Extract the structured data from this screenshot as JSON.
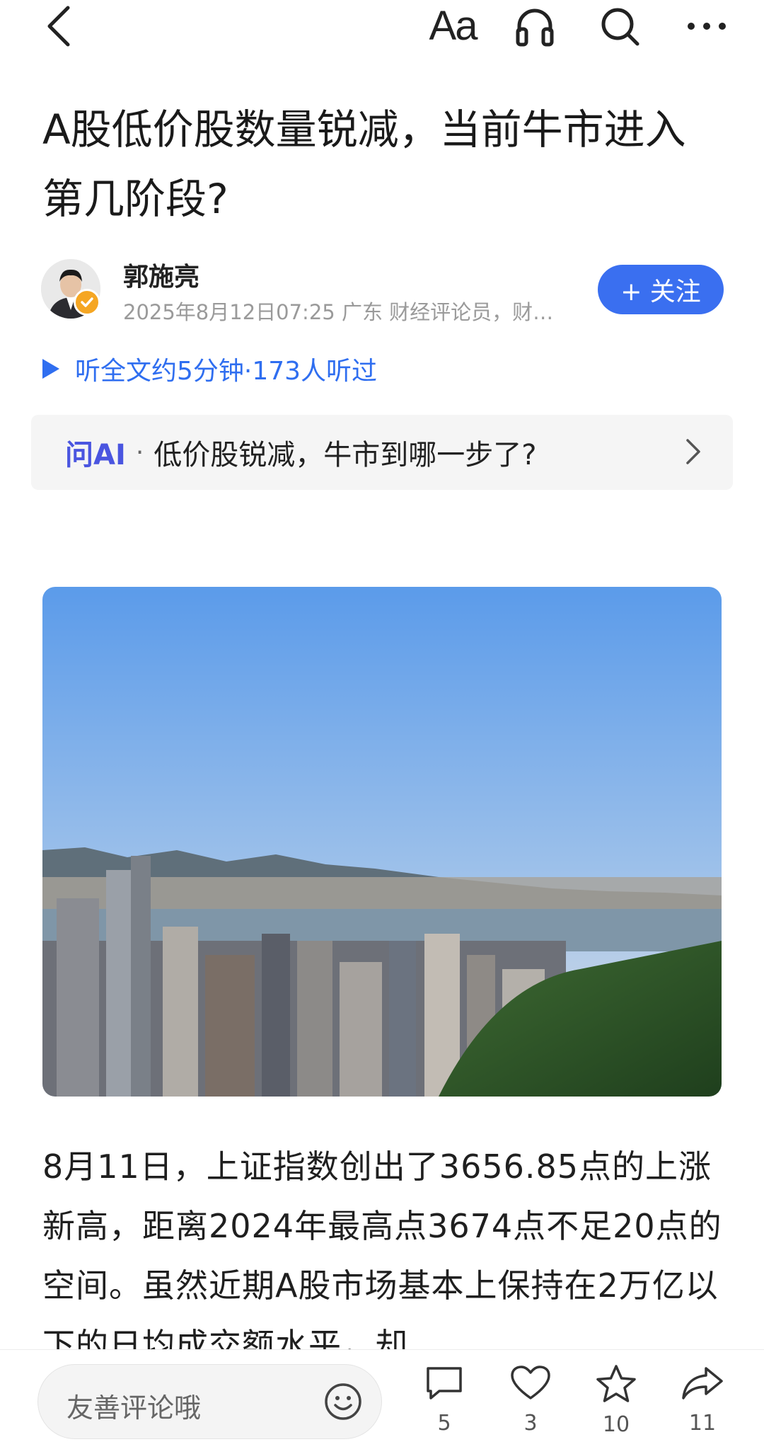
{
  "topbar": {
    "back_icon": "chevron-left-icon",
    "font_label": "Aa",
    "listen_icon": "headphones-icon",
    "search_icon": "search-icon",
    "more_icon": "more-dots-icon"
  },
  "article": {
    "title": "A股低价股数量锐减，当前牛市进入第几阶段?",
    "author": {
      "name": "郭施亮",
      "meta": "2025年8月12日07:25 广东 财经评论员，财…",
      "follow_label": "+ 关注"
    },
    "listen_label": "听全文约5分钟·173人听过",
    "ask_ai": {
      "label": "问AI",
      "separator": "·",
      "question": "低价股锐减，牛市到哪一步了?"
    },
    "body": "8月11日，上证指数创出了3656.85点的上涨新高，距离2024年最高点3674点不足20点的空间。虽然近期A股市场基本上保持在2万亿以下的日均成交额水平，却"
  },
  "bottombar": {
    "comment_placeholder": "友善评论哦",
    "actions": [
      {
        "name": "comment",
        "icon": "comment-icon",
        "count": "5"
      },
      {
        "name": "like",
        "icon": "heart-icon",
        "count": "3"
      },
      {
        "name": "favorite",
        "icon": "star-icon",
        "count": "10"
      },
      {
        "name": "share",
        "icon": "share-icon",
        "count": "11"
      }
    ]
  },
  "colors": {
    "accent_blue": "#3a6ff0",
    "ai_purple": "#4a55e0",
    "meta_gray": "#9a9a9a",
    "verified_orange": "#f5a623"
  }
}
